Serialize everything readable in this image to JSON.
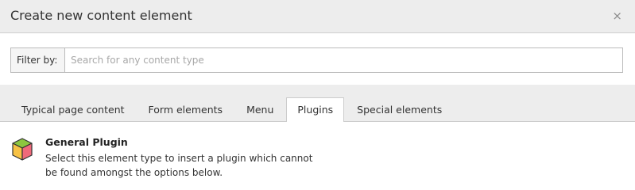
{
  "modal": {
    "title": "Create new content element",
    "close_glyph": "×"
  },
  "filter": {
    "label": "Filter by:",
    "placeholder": "Search for any content type",
    "value": ""
  },
  "tabs": [
    {
      "label": "Typical page content",
      "active": false
    },
    {
      "label": "Form elements",
      "active": false
    },
    {
      "label": "Menu",
      "active": false
    },
    {
      "label": "Plugins",
      "active": true
    },
    {
      "label": "Special elements",
      "active": false
    }
  ],
  "plugins": {
    "items": [
      {
        "icon": "plugin-cube-icon",
        "title": "General Plugin",
        "description": "Select this element type to insert a plugin which cannot be found amongst the options below."
      }
    ]
  },
  "colors": {
    "header_bg": "#ededed",
    "cube_top": "#8cc63f",
    "cube_left": "#f7c244",
    "cube_right": "#f0697a"
  }
}
